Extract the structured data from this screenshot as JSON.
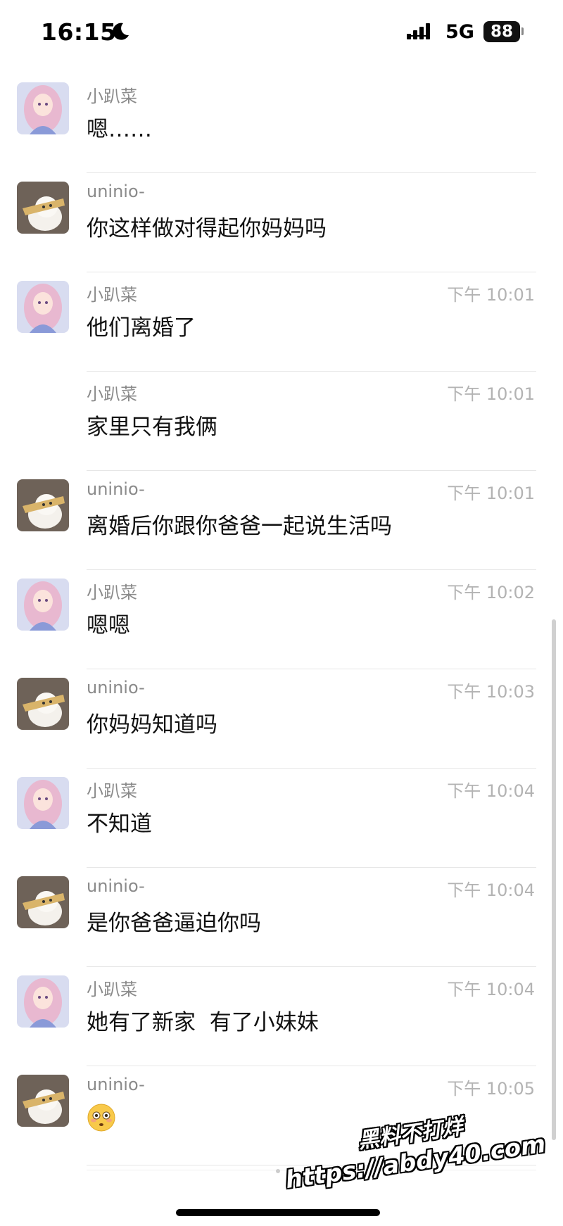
{
  "status_bar": {
    "time": "16:15",
    "network": "5G",
    "battery": "88"
  },
  "messages": [
    {
      "sender": "小趴菜",
      "avatar": "girl-avatar",
      "time": "",
      "text": "嗯……"
    },
    {
      "sender": "uninio-",
      "avatar": "cat-avatar",
      "time": "",
      "text": "你这样做对得起你妈妈吗"
    },
    {
      "sender": "小趴菜",
      "avatar": "girl-avatar",
      "time": "下午 10:01",
      "text": "他们离婚了"
    },
    {
      "sender": "小趴菜",
      "avatar": "",
      "time": "下午 10:01",
      "text": "家里只有我俩"
    },
    {
      "sender": "uninio-",
      "avatar": "cat-avatar",
      "time": "下午 10:01",
      "text": "离婚后你跟你爸爸一起说生活吗"
    },
    {
      "sender": "小趴菜",
      "avatar": "girl-avatar",
      "time": "下午 10:02",
      "text": "嗯嗯"
    },
    {
      "sender": "uninio-",
      "avatar": "cat-avatar",
      "time": "下午 10:03",
      "text": "你妈妈知道吗"
    },
    {
      "sender": "小趴菜",
      "avatar": "girl-avatar",
      "time": "下午 10:04",
      "text": "不知道"
    },
    {
      "sender": "uninio-",
      "avatar": "cat-avatar",
      "time": "下午 10:04",
      "text": "是你爸爸逼迫你吗"
    },
    {
      "sender": "小趴菜",
      "avatar": "girl-avatar",
      "time": "下午 10:04",
      "text": "她有了新家  有了小妹妹"
    },
    {
      "sender": "uninio-",
      "avatar": "cat-avatar",
      "time": "下午 10:05",
      "text": "",
      "emoji": "flushed-face-icon"
    }
  ],
  "watermark": {
    "line1": "黑料不打烊",
    "line2": "https://abdy40.com"
  }
}
